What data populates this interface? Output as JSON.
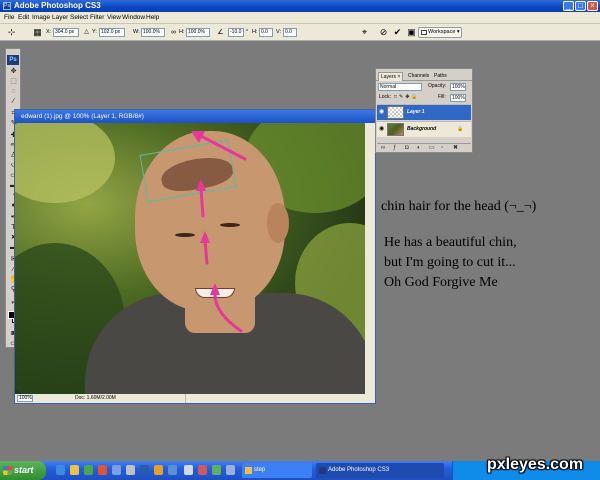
{
  "app": {
    "title": "Adobe Photoshop CS3",
    "logo_text": "Ps"
  },
  "window_controls": {
    "minimize": "_",
    "maximize": "□",
    "close": "×"
  },
  "menu": [
    "File",
    "Edit",
    "Image",
    "Layer",
    "Select",
    "Filter",
    "View",
    "Window",
    "Help"
  ],
  "options_bar": {
    "x_label": "X:",
    "x_value": "304.0 px",
    "y_label": "Y:",
    "y_value": "102.0 px",
    "w_label": "W:",
    "w_value": "100.0%",
    "h_label": "H:",
    "h_value": "100.0%",
    "angle_value": "-10.0",
    "hskew_label": "H:",
    "hskew_value": "0.0",
    "vskew_label": "V:",
    "vskew_value": "0.0",
    "workspace_label": "Workspace ▾"
  },
  "document": {
    "title": "edward (1).jpg @ 100% (Layer 1, RGB/8#)",
    "zoom": "100%",
    "doc_info": "Doc: 1.60M/2.00M"
  },
  "layers_panel": {
    "tabs": [
      "Layers ×",
      "Channels",
      "Paths"
    ],
    "blend_mode": "Normal",
    "opacity_label": "Opacity:",
    "opacity_value": "100%",
    "lock_label": "Lock:",
    "fill_label": "Fill:",
    "fill_value": "100%",
    "layers": [
      {
        "name": "Layer 1",
        "selected": true
      },
      {
        "name": "Background",
        "selected": false
      }
    ]
  },
  "caption": {
    "line1": "chin hair for the head (¬_¬)",
    "line2": "He has a beautiful chin,",
    "line3": "but I'm going to cut it...",
    "line4": "Oh God Forgive Me"
  },
  "taskbar": {
    "start_label": "start",
    "tasks": [
      "step",
      "Adobe Photoshop CS3"
    ]
  },
  "watermark": "pxleyes.com",
  "colors": {
    "accent_pink": "#e8369a",
    "transform_box": "#5fb8a0",
    "desktop_gray": "#7b7b7b",
    "xp_blue": "#245edb"
  }
}
